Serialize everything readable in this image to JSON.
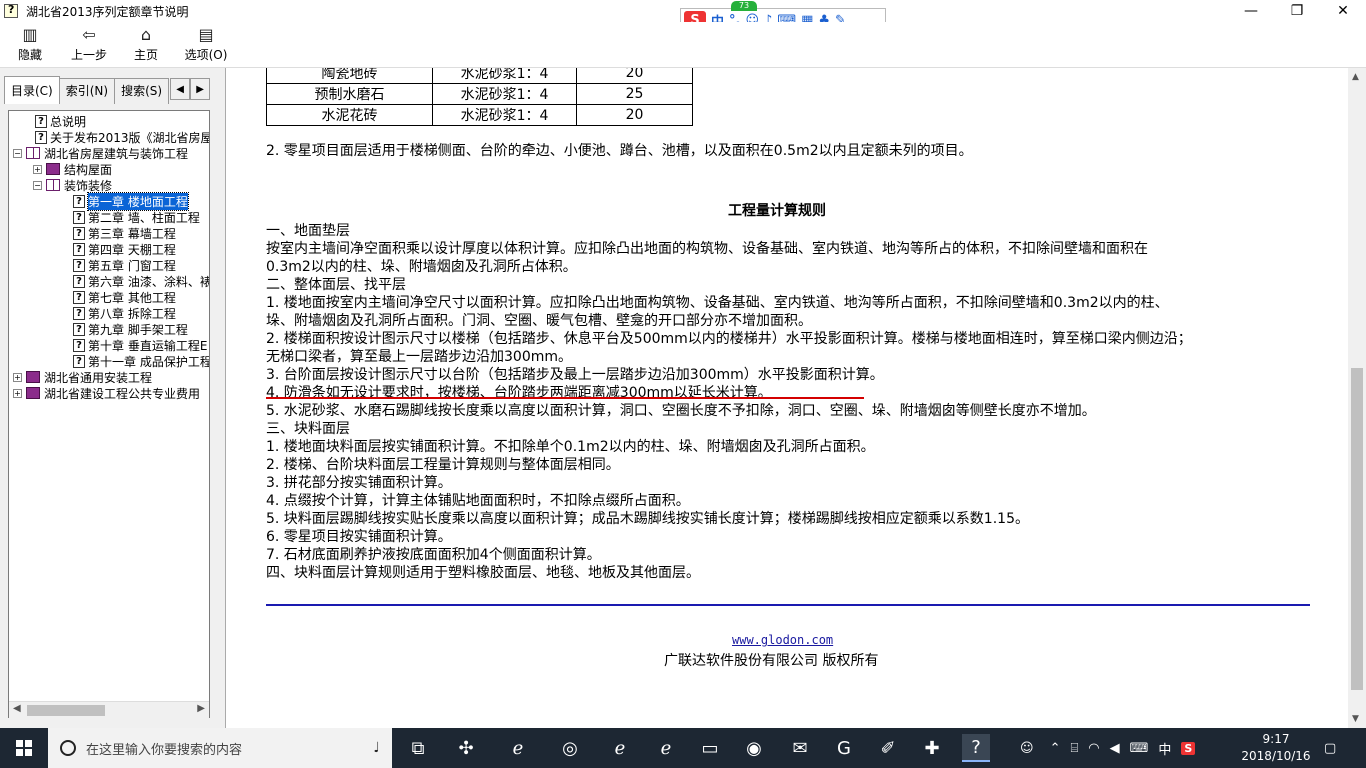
{
  "window": {
    "title": "湖北省2013序列定额章节说明",
    "min": "—",
    "max": "❐",
    "close": "✕"
  },
  "ime": {
    "logo": "S",
    "mode": "中",
    "punct": "°,",
    "badge": "73"
  },
  "toolbar": {
    "hide": "隐藏",
    "back": "上一步",
    "home": "主页",
    "options": "选项(O)"
  },
  "tabs": {
    "contents": "目录(C)",
    "index": "索引(N)",
    "search": "搜索(S)"
  },
  "tree": [
    {
      "label": "总说明",
      "level": 1,
      "icon": "q"
    },
    {
      "label": "关于发布2013版《湖北省房屋",
      "level": 1,
      "icon": "q"
    },
    {
      "label": "湖北省房屋建筑与装饰工程",
      "level": 0,
      "icon": "book-open",
      "exp": "−"
    },
    {
      "label": "结构屋面",
      "level": 1,
      "icon": "book",
      "exp": "+"
    },
    {
      "label": "装饰装修",
      "level": 1,
      "icon": "book-open",
      "exp": "−"
    },
    {
      "label": "第一章  楼地面工程",
      "level": 2,
      "icon": "q",
      "selected": true
    },
    {
      "label": "第二章  墙、柱面工程",
      "level": 2,
      "icon": "q"
    },
    {
      "label": "第三章  幕墙工程",
      "level": 2,
      "icon": "q"
    },
    {
      "label": "第四章  天棚工程",
      "level": 2,
      "icon": "q"
    },
    {
      "label": "第五章  门窗工程",
      "level": 2,
      "icon": "q"
    },
    {
      "label": "第六章  油漆、涂料、裱",
      "level": 2,
      "icon": "q"
    },
    {
      "label": "第七章  其他工程",
      "level": 2,
      "icon": "q"
    },
    {
      "label": "第八章  拆除工程",
      "level": 2,
      "icon": "q"
    },
    {
      "label": "第九章  脚手架工程",
      "level": 2,
      "icon": "q"
    },
    {
      "label": "第十章  垂直运输工程E",
      "level": 2,
      "icon": "q"
    },
    {
      "label": "第十一章  成品保护工程",
      "level": 2,
      "icon": "q"
    },
    {
      "label": "湖北省通用安装工程",
      "level": 0,
      "icon": "book",
      "exp": "+"
    },
    {
      "label": "湖北省建设工程公共专业费用",
      "level": 0,
      "icon": "book",
      "exp": "+"
    }
  ],
  "table": {
    "rows": [
      [
        "陶瓷地砖",
        "水泥砂浆1：4",
        "20"
      ],
      [
        "预制水磨石",
        "水泥砂浆1：4",
        "25"
      ],
      [
        "水泥花砖",
        "水泥砂浆1：4",
        "20"
      ]
    ]
  },
  "content": {
    "note2": "2. 零星项目面层适用于楼梯侧面、台阶的牵边、小便池、蹲台、池槽，以及面积在0.5m2以内且定额未列的项目。",
    "heading": "工程量计算规则",
    "lines": [
      "一、地面垫层",
      "按室内主墙间净空面积乘以设计厚度以体积计算。应扣除凸出地面的构筑物、设备基础、室内铁道、地沟等所占的体积，不扣除间壁墙和面积在",
      "0.3m2以内的柱、垛、附墙烟囱及孔洞所占体积。",
      "二、整体面层、找平层",
      "1. 楼地面按室内主墙间净空尺寸以面积计算。应扣除凸出地面构筑物、设备基础、室内铁道、地沟等所占面积，不扣除间壁墙和0.3m2以内的柱、",
      "垛、附墙烟囱及孔洞所占面积。门洞、空圈、暖气包槽、壁龛的开口部分亦不增加面积。",
      "2. 楼梯面积按设计图示尺寸以楼梯（包括踏步、休息平台及500mm以内的楼梯井）水平投影面积计算。楼梯与楼地面相连时，算至梯口梁内侧边沿；",
      "无梯口梁者，算至最上一层踏步边沿加300mm。",
      "3. 台阶面层按设计图示尺寸以台阶（包括踏步及最上一层踏步边沿加300mm）水平投影面积计算。",
      "4. 防滑条如无设计要求时，按楼梯、台阶踏步两端距离减300mm以延长米计算。",
      "5. 水泥砂浆、水磨石踢脚线按长度乘以高度以面积计算，洞口、空圈长度不予扣除，洞口、空圈、垛、附墙烟囱等侧壁长度亦不增加。",
      "三、块料面层",
      "1. 楼地面块料面层按实铺面积计算。不扣除单个0.1m2以内的柱、垛、附墙烟囱及孔洞所占面积。",
      "2. 楼梯、台阶块料面层工程量计算规则与整体面层相同。",
      "3. 拼花部分按实铺面积计算。",
      "4. 点缀按个计算，计算主体铺贴地面面积时，不扣除点缀所占面积。",
      "5. 块料面层踢脚线按实贴长度乘以高度以面积计算；成品木踢脚线按实铺长度计算；楼梯踢脚线按相应定额乘以系数1.15。",
      "6. 零星项目按实铺面积计算。",
      "7. 石材底面刷养护液按底面面积加4个侧面面积计算。",
      "四、块料面层计算规则适用于塑料橡胶面层、地毯、地板及其他面层。"
    ],
    "link": "www.glodon.com",
    "copyright": "广联达软件股份有限公司 版权所有"
  },
  "taskbar": {
    "search_placeholder": "在这里输入你要搜索的内容",
    "time": "9:17",
    "date": "2018/10/16",
    "lang": "中"
  }
}
